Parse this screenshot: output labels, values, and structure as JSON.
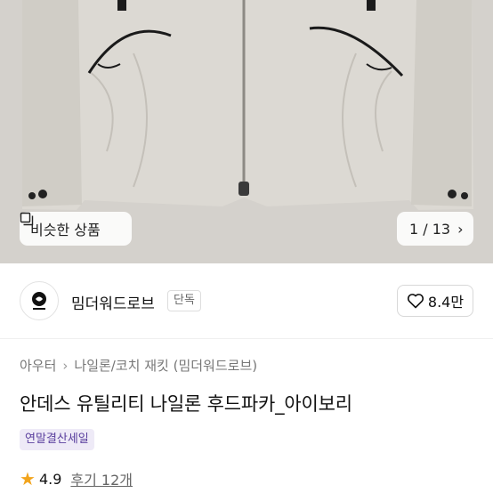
{
  "product_image": {
    "similar_label": "비슷한 상품",
    "counter": "1 / 13"
  },
  "shop": {
    "name": "밈더워드로브",
    "badge": "단독",
    "likes": "8.4만"
  },
  "breadcrumb": [
    "아우터",
    "나일론/코치 재킷 (밈더워드로브)"
  ],
  "product": {
    "title": "안데스 유틸리티 나일론 후드파카_아이보리",
    "sale_badge": "연말결산세일",
    "rating": "4.9",
    "reviews": "후기 12개"
  },
  "colors": {
    "star": "#f2a41c",
    "sale_badge_bg": "#eeeaf7",
    "sale_badge_text": "#5a3f9e",
    "jacket": "#dcd9d3"
  },
  "icons": {
    "similar": "similar-items-icon",
    "next": "chevron-right-icon",
    "like": "heart-icon",
    "rating": "star-icon"
  }
}
